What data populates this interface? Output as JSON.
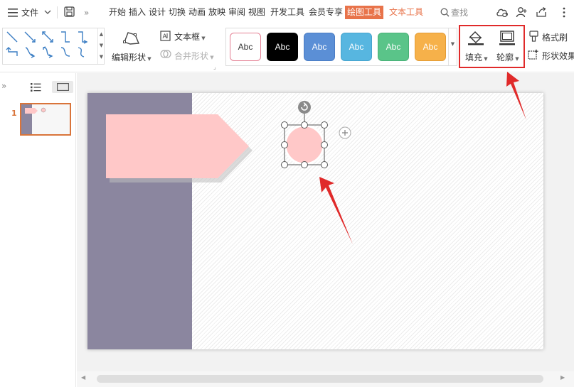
{
  "menubar": {
    "file_label": "文件",
    "tabs": [
      {
        "label": "开始"
      },
      {
        "label": "插入"
      },
      {
        "label": "设计"
      },
      {
        "label": "切换"
      },
      {
        "label": "动画"
      },
      {
        "label": "放映"
      },
      {
        "label": "审阅"
      },
      {
        "label": "视图"
      },
      {
        "label": "开发工具"
      },
      {
        "label": "会员专享"
      },
      {
        "label": "绘图工具"
      },
      {
        "label": "文本工具"
      }
    ],
    "active_tab": "绘图工具",
    "search_label": "查找"
  },
  "ribbon": {
    "edit_shape_label": "编辑形状",
    "textbox_label": "文本框",
    "merge_shape_label": "合并形状",
    "shape_styles": [
      {
        "text": "Abc",
        "bg": "#ffffff",
        "fg": "#333333",
        "border": "#e47f93"
      },
      {
        "text": "Abc",
        "bg": "#000000",
        "fg": "#ffffff",
        "border": "#000000"
      },
      {
        "text": "Abc",
        "bg": "#5b8fd6",
        "fg": "#ffffff",
        "border": "#4a7cc4"
      },
      {
        "text": "Abc",
        "bg": "#57b6e0",
        "fg": "#ffffff",
        "border": "#45a3cd"
      },
      {
        "text": "Abc",
        "bg": "#5ac489",
        "fg": "#ffffff",
        "border": "#48b076"
      },
      {
        "text": "Abc",
        "bg": "#f6b14a",
        "fg": "#ffffff",
        "border": "#e39c35"
      }
    ],
    "fill_label": "填充",
    "outline_label": "轮廓",
    "format_painter_label": "格式刷",
    "shape_effects_label": "形状效果"
  },
  "slides_panel": {
    "slide_number": "1"
  },
  "colors": {
    "accent": "#e8734a",
    "band": "#8b869f",
    "pink": "#ffc8c8",
    "annotation": "#e02a2a"
  }
}
